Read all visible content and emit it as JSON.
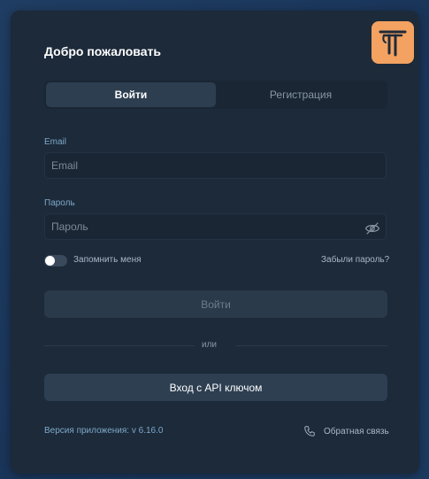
{
  "login": {
    "title": "Добро пожаловать",
    "tabs": [
      {
        "label": "Войти",
        "active": true
      },
      {
        "label": "Регистрация",
        "active": false
      }
    ],
    "email": {
      "label": "Email",
      "placeholder": "Email"
    },
    "password": {
      "label": "Пароль",
      "placeholder": "Пароль"
    },
    "remember_label": "Запомнить меня",
    "remember_on": false,
    "forgot_label": "Забыли пароль?",
    "submit_label": "Войти",
    "divider_label": "или",
    "api_login_label": "Вход с API ключом",
    "version_text": "Версия приложения: v 6.16.0",
    "feedback_label": "Обратная связь"
  },
  "colors": {
    "accent": "#f4a261",
    "card": "#1c2a3a",
    "background": "#1e3a5c"
  },
  "icons": {
    "logo": "app-logo-icon",
    "password_toggle": "eye-off-icon",
    "feedback": "phone-icon"
  }
}
